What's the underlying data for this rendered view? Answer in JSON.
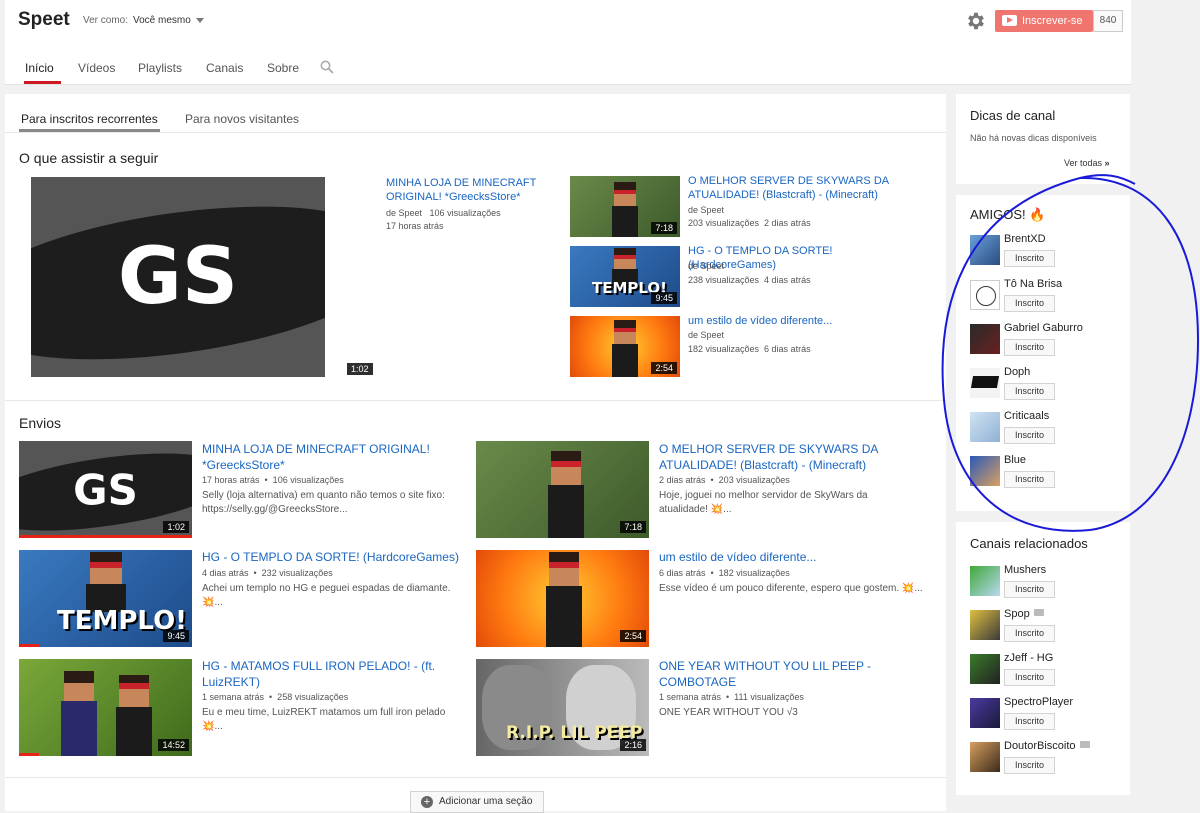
{
  "header": {
    "channel_name": "Speet",
    "view_as_label": "Ver como:",
    "view_as_value": "Você mesmo",
    "subscribe_label": "Inscrever-se",
    "subscriber_count": "840",
    "tabs": [
      "Início",
      "Vídeos",
      "Playlists",
      "Canais",
      "Sobre"
    ]
  },
  "main": {
    "subtabs": [
      "Para inscritos recorrentes",
      "Para novos visitantes"
    ],
    "featured": {
      "section_title": "O que assistir a seguir",
      "big_thumb_text": "GS",
      "big_duration": "1:02",
      "title": "MINHA LOJA DE MINECRAFT ORIGINAL! *GreecksStore*",
      "by": "de Speet",
      "views": "106 visualizações",
      "age": "17 horas atrás"
    },
    "side_videos": [
      {
        "title": "O MELHOR SERVER DE SKYWARS DA ATUALIDADE! (Blastcraft) - (Minecraft)",
        "by": "de Speet",
        "meta": "203 visualizações  2 dias atrás",
        "duration": "7:18"
      },
      {
        "title": "HG - O TEMPLO DA SORTE! (HardcoreGames)",
        "by": "de Speet",
        "meta": "238 visualizações  4 dias atrás",
        "duration": "9:45",
        "thumb_text": "TEMPLO!"
      },
      {
        "title": "um estilo de vídeo diferente...",
        "by": "de Speet",
        "meta": "182 visualizações  6 dias atrás",
        "duration": "2:54"
      }
    ],
    "uploads": {
      "section_title": "Envios",
      "items": [
        {
          "title": "MINHA LOJA DE MINECRAFT ORIGINAL! *GreecksStore*",
          "meta": "17 horas atrás  •  106 visualizações",
          "desc": "Selly (loja alternativa) em quanto não temos o site fixo: https://selly.gg/@GreecksStore...",
          "duration": "1:02",
          "thumb_text": "GS"
        },
        {
          "title": "O MELHOR SERVER DE SKYWARS DA ATUALIDADE! (Blastcraft) - (Minecraft)",
          "meta": "2 dias atrás  •  203 visualizações",
          "desc": "Hoje, joguei no melhor servidor de SkyWars da atualidade! 💥...",
          "duration": "7:18"
        },
        {
          "title": "HG - O TEMPLO DA SORTE! (HardcoreGames)",
          "meta": "4 dias atrás  •  232 visualizações",
          "desc": "Achei um templo no HG e peguei espadas de diamante. 💥...",
          "duration": "9:45",
          "thumb_text": "TEMPLO!"
        },
        {
          "title": "um estilo de vídeo diferente...",
          "meta": "6 dias atrás  •  182 visualizações",
          "desc": "Esse vídeo é um pouco diferente, espero que gostem. 💥...",
          "duration": "2:54"
        },
        {
          "title": "HG - MATAMOS FULL IRON PELADO! - (ft. LuizREKT)",
          "meta": "1 semana atrás  •  258 visualizações",
          "desc": "Eu e meu time, LuizREKT matamos um full iron pelado 💥...",
          "duration": "14:52"
        },
        {
          "title": "ONE YEAR WITHOUT YOU LIL PEEP - COMBOTAGE",
          "meta": "1 semana atrás  •  111 visualizações",
          "desc": "ONE YEAR WITHOUT YOU √3",
          "duration": "2:16",
          "thumb_text": "R.I.P. LIL PEEP"
        }
      ]
    },
    "add_section": "Adicionar uma seção"
  },
  "sidebar": {
    "tips": {
      "title": "Dicas de canal",
      "text": "Não há novas dicas disponíveis",
      "link": "Ver todas"
    },
    "friends": {
      "title": "AMIGOS! 🔥",
      "subscribed_label": "Inscrito",
      "channels": [
        "BrentXD",
        "Tô Na Brisa",
        "Gabriel Gaburro",
        "Doph",
        "Criticaals",
        "Blue"
      ]
    },
    "related": {
      "title": "Canais relacionados",
      "channels": [
        "Mushers",
        "Spop",
        "zJeff - HG",
        "SpectroPlayer",
        "DoutorBiscoito"
      ]
    }
  },
  "colors": {
    "accent_red": "#e62117",
    "link_blue": "#1a66c2",
    "annotation_blue": "#1a1ad8"
  }
}
